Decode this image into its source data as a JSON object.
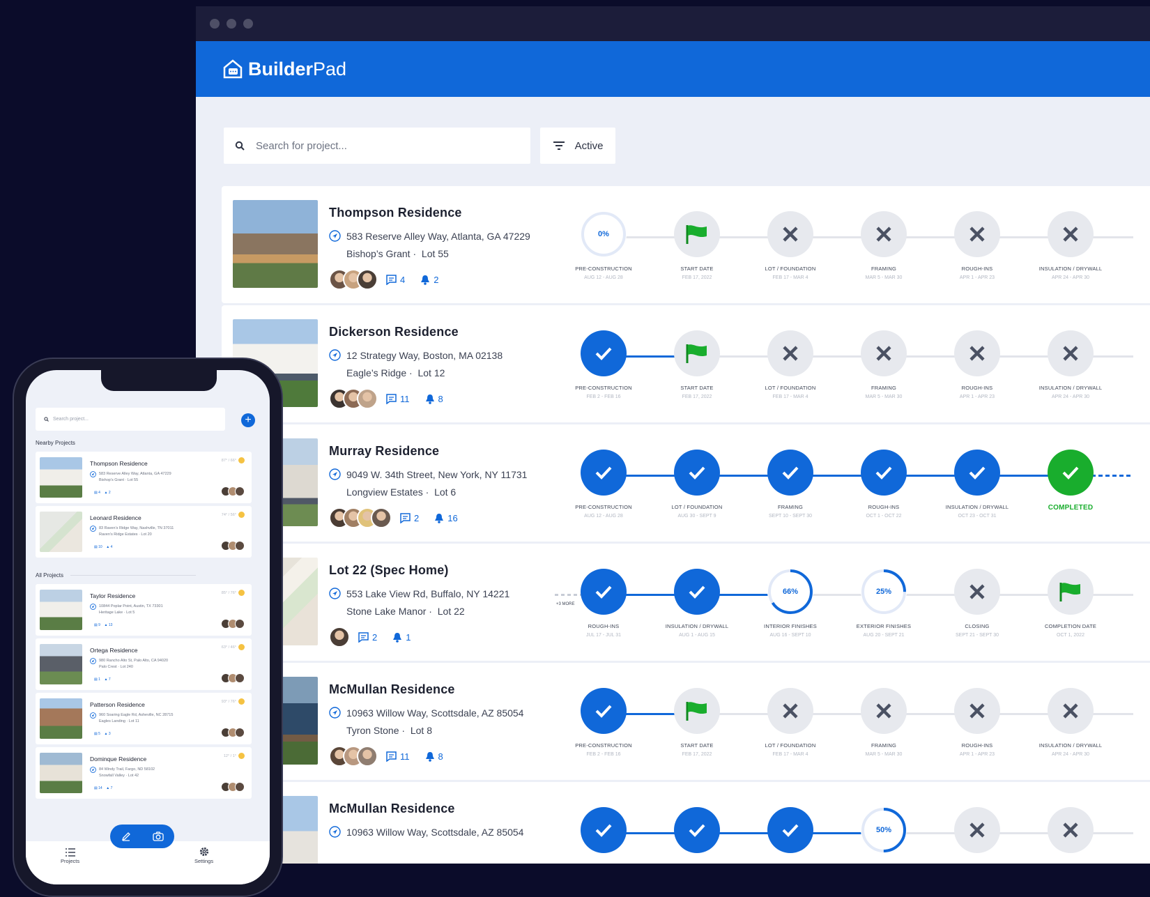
{
  "window": {
    "title": "BuilderPad"
  },
  "brand": {
    "name_bold": "Builder",
    "name_rest": "Pad",
    "color": "#1068d9"
  },
  "search": {
    "placeholder": "Search for project..."
  },
  "filter": {
    "label": "Active"
  },
  "projects": [
    {
      "name": "Thompson Residence",
      "address": "583 Reserve Alley Way, Atlanta, GA 47229",
      "community": "Bishop’s Grant",
      "lot": "Lot 55",
      "messages": "4",
      "alerts": "2",
      "steps": [
        {
          "label": "PRE-CONSTRUCTION",
          "date": "AUG 12 - AUG 28",
          "state": "ring",
          "pct": "0"
        },
        {
          "label": "START DATE",
          "date": "FEB 17, 2022",
          "state": "flag"
        },
        {
          "label": "LOT / FOUNDATION",
          "date": "FEB 17 - MAR 4",
          "state": "x"
        },
        {
          "label": "FRAMING",
          "date": "MAR 5 - MAR 30",
          "state": "x"
        },
        {
          "label": "ROUGH-INS",
          "date": "APR 1 - APR 23",
          "state": "x"
        },
        {
          "label": "INSULATION / DRYWALL",
          "date": "APR 24 - APR 30",
          "state": "x"
        }
      ]
    },
    {
      "name": "Dickerson Residence",
      "address": "12 Strategy Way, Boston, MA 02138",
      "community": "Eagle’s Ridge",
      "lot": "Lot 12",
      "messages": "11",
      "alerts": "8",
      "steps": [
        {
          "label": "PRE-CONSTRUCTION",
          "date": "FEB 2 - FEB 16",
          "state": "done"
        },
        {
          "label": "START DATE",
          "date": "FEB 17, 2022",
          "state": "flag"
        },
        {
          "label": "LOT / FOUNDATION",
          "date": "FEB 17 - MAR 4",
          "state": "x"
        },
        {
          "label": "FRAMING",
          "date": "MAR 5 - MAR 30",
          "state": "x"
        },
        {
          "label": "ROUGH-INS",
          "date": "APR 1 - APR 23",
          "state": "x"
        },
        {
          "label": "INSULATION / DRYWALL",
          "date": "APR 24 - APR 30",
          "state": "x"
        }
      ]
    },
    {
      "name": "Murray Residence",
      "address": "9049 W. 34th Street, New York, NY 11731",
      "community": "Longview Estates",
      "lot": "Lot 6",
      "messages": "2",
      "alerts": "16",
      "steps": [
        {
          "label": "PRE-CONSTRUCTION",
          "date": "AUG 12 - AUG 28",
          "state": "done"
        },
        {
          "label": "LOT / FOUNDATION",
          "date": "AUG 30 - SEPT 9",
          "state": "done"
        },
        {
          "label": "FRAMING",
          "date": "SEPT 10 - SEPT 30",
          "state": "done"
        },
        {
          "label": "ROUGH-INS",
          "date": "OCT 1 - OCT 22",
          "state": "done"
        },
        {
          "label": "INSULATION / DRYWALL",
          "date": "OCT 23 - OCT 31",
          "state": "done"
        },
        {
          "label": "COMPLETED",
          "date": "",
          "state": "green"
        }
      ]
    },
    {
      "name": "Lot 22 (Spec Home)",
      "address": "553 Lake View Rd, Buffalo, NY 14221",
      "community": "Stone Lake Manor",
      "lot": "Lot 22",
      "messages": "2",
      "alerts": "1",
      "more": "+3 MORE",
      "steps": [
        {
          "label": "ROUGH-INS",
          "date": "JUL 17 - JUL 31",
          "state": "done"
        },
        {
          "label": "INSULATION / DRYWALL",
          "date": "AUG 1 - AUG 15",
          "state": "done"
        },
        {
          "label": "INTERIOR FINISHES",
          "date": "AUG 16 - SEPT 10",
          "state": "ring",
          "pct": "66"
        },
        {
          "label": "EXTERIOR FINISHES",
          "date": "AUG 20 - SEPT 21",
          "state": "ring",
          "pct": "25"
        },
        {
          "label": "CLOSING",
          "date": "SEPT 21 - SEPT 30",
          "state": "x"
        },
        {
          "label": "COMPLETION DATE",
          "date": "OCT 1, 2022",
          "state": "flag"
        }
      ]
    },
    {
      "name": "McMullan Residence",
      "address": "10963 Willow Way, Scottsdale, AZ 85054",
      "community": "Tyron Stone",
      "lot": "Lot 8",
      "messages": "11",
      "alerts": "8",
      "steps": [
        {
          "label": "PRE-CONSTRUCTION",
          "date": "FEB 2 - FEB 16",
          "state": "done"
        },
        {
          "label": "START DATE",
          "date": "FEB 17, 2022",
          "state": "flag"
        },
        {
          "label": "LOT / FOUNDATION",
          "date": "FEB 17 - MAR 4",
          "state": "x"
        },
        {
          "label": "FRAMING",
          "date": "MAR 5 - MAR 30",
          "state": "x"
        },
        {
          "label": "ROUGH-INS",
          "date": "APR 1 - APR 23",
          "state": "x"
        },
        {
          "label": "INSULATION / DRYWALL",
          "date": "APR 24 - APR 30",
          "state": "x"
        }
      ]
    },
    {
      "name": "McMullan Residence",
      "address": "10963 Willow Way, Scottsdale, AZ 85054",
      "community": "",
      "lot": "",
      "messages": "",
      "alerts": "",
      "steps": [
        {
          "label": "",
          "date": "",
          "state": "done"
        },
        {
          "label": "",
          "date": "",
          "state": "done"
        },
        {
          "label": "",
          "date": "",
          "state": "done"
        },
        {
          "label": "",
          "date": "",
          "state": "ring",
          "pct": "50"
        },
        {
          "label": "",
          "date": "",
          "state": "x"
        },
        {
          "label": "",
          "date": "",
          "state": "x"
        }
      ]
    }
  ],
  "mobile": {
    "search_placeholder": "Search project...",
    "nearby_title": "Nearby Projects",
    "all_title": "All Projects",
    "nearby": [
      {
        "name": "Thompson Residence",
        "addr1": "583 Reserve Alley Way, Atlanta, GA 47229",
        "addr2": "Bishop’s Grant · Lot 55",
        "msgs": "4",
        "alerts": "2",
        "temp": "87° / 66°"
      },
      {
        "name": "Leonard Residence",
        "addr1": "83 Raven’s Ridge Way, Nashville, TN 37011",
        "addr2": "Raven’s Ridge Estates · Lot 20",
        "msgs": "10",
        "alerts": "4",
        "temp": "74° / 56°"
      }
    ],
    "all": [
      {
        "name": "Taylor Residence",
        "addr1": "10844 Poplar Point, Austin, TX 73301",
        "addr2": "Heritage Lake · Lot 5",
        "msgs": "9",
        "alerts": "13",
        "temp": "85° / 76°"
      },
      {
        "name": "Ortega Residence",
        "addr1": "980 Rancho Alto St, Palo Alto, CA 94020",
        "addr2": "Palo Crest · Lot 240",
        "msgs": "1",
        "alerts": "7",
        "temp": "63° / 46°"
      },
      {
        "name": "Patterson Residence",
        "addr1": "960 Soaring Eagle Rd, Asheville, NC 28715",
        "addr2": "Eagles Landing · Lot 11",
        "msgs": "5",
        "alerts": "3",
        "temp": "93° / 76°"
      },
      {
        "name": "Dominque Residence",
        "addr1": "84 Windy Trail, Fargo, ND 58102",
        "addr2": "Snowfall Valley · Lot 42",
        "msgs": "14",
        "alerts": "7",
        "temp": "12° / 1°"
      }
    ],
    "tabs": {
      "projects": "Projects",
      "settings": "Settings"
    }
  }
}
